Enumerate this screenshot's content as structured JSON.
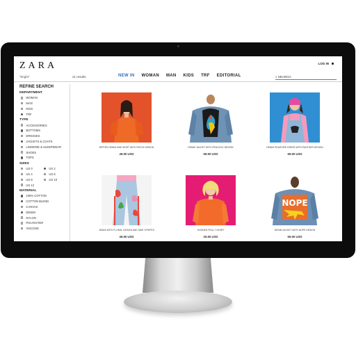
{
  "header": {
    "logo": "ZARA",
    "login_label": "LOG IN",
    "search_term": "\"bright\"",
    "results_count": "21 results",
    "nav": [
      {
        "label": "NEW IN",
        "active": true
      },
      {
        "label": "WOMAN",
        "active": false
      },
      {
        "label": "MAN",
        "active": false
      },
      {
        "label": "KIDS",
        "active": false
      },
      {
        "label": "TRF",
        "active": false
      },
      {
        "label": "EDITORIAL",
        "active": false
      }
    ],
    "search_placeholder": "SEARCH"
  },
  "sidebar": {
    "title": "REFINE SEARCH",
    "department": {
      "title": "DEPARTMENT",
      "options": [
        {
          "label": "WOMAN",
          "checked": false
        },
        {
          "label": "MAN",
          "checked": false
        },
        {
          "label": "KIDS",
          "checked": false
        },
        {
          "label": "TRF",
          "checked": true
        }
      ]
    },
    "type": {
      "title": "TYPE",
      "options": [
        {
          "label": "ACCESSORIES",
          "checked": false
        },
        {
          "label": "BOTTOMS",
          "checked": true
        },
        {
          "label": "DRESSES",
          "checked": false
        },
        {
          "label": "JACKETS & COATS",
          "checked": true
        },
        {
          "label": "LINGERIE & SLEEPWEAR",
          "checked": false
        },
        {
          "label": "SHOES",
          "checked": false
        },
        {
          "label": "TOPS",
          "checked": true
        }
      ]
    },
    "sizes": {
      "title": "SIZES",
      "options": [
        {
          "label": "US 0",
          "checked": false
        },
        {
          "label": "US 2",
          "checked": true
        },
        {
          "label": "US 4",
          "checked": false
        },
        {
          "label": "US 6",
          "checked": false
        },
        {
          "label": "US 8",
          "checked": false
        },
        {
          "label": "US 10",
          "checked": false
        },
        {
          "label": "US 12",
          "checked": false
        }
      ]
    },
    "material": {
      "title": "MATERIAL",
      "options": [
        {
          "label": "100% COTTON",
          "checked": true
        },
        {
          "label": "COTTON BLEND",
          "checked": true
        },
        {
          "label": "CANVAS",
          "checked": false
        },
        {
          "label": "DENIM",
          "checked": true
        },
        {
          "label": "NYLON",
          "checked": false
        },
        {
          "label": "POLYESTER",
          "checked": false
        },
        {
          "label": "VISCOSE",
          "checked": false
        }
      ]
    }
  },
  "products": [
    {
      "name": "RIPPED DENIM MIDI SKIRT WITH PATCH DESIGN",
      "price": "49.90 USD",
      "bg": "#e3522b"
    },
    {
      "name": "DENIM JACKET WITH PEACOCK DESIGN",
      "price": "69.90 USD",
      "bg": "#ffffff"
    },
    {
      "name": "DENIM PINAFORE DRESS WITH PANTHER DESIGN",
      "price": "69.90 USD",
      "bg": "#2f8fd2"
    },
    {
      "name": "JEANS WITH FLORAL DESIGN AND SIDE STRIPES",
      "price": "49.90 USD",
      "bg": "#f4f4f4"
    },
    {
      "name": "HOODED FRILL T-SHIRT",
      "price": "25.90 USD",
      "bg": "#e51c73"
    },
    {
      "name": "DENIM JACKET WITH NOPE DESIGN",
      "price": "69.90 USD",
      "bg": "#ffffff"
    }
  ],
  "jacket_text": "NOPE",
  "colors": {
    "accent": "#2e6fb5"
  }
}
